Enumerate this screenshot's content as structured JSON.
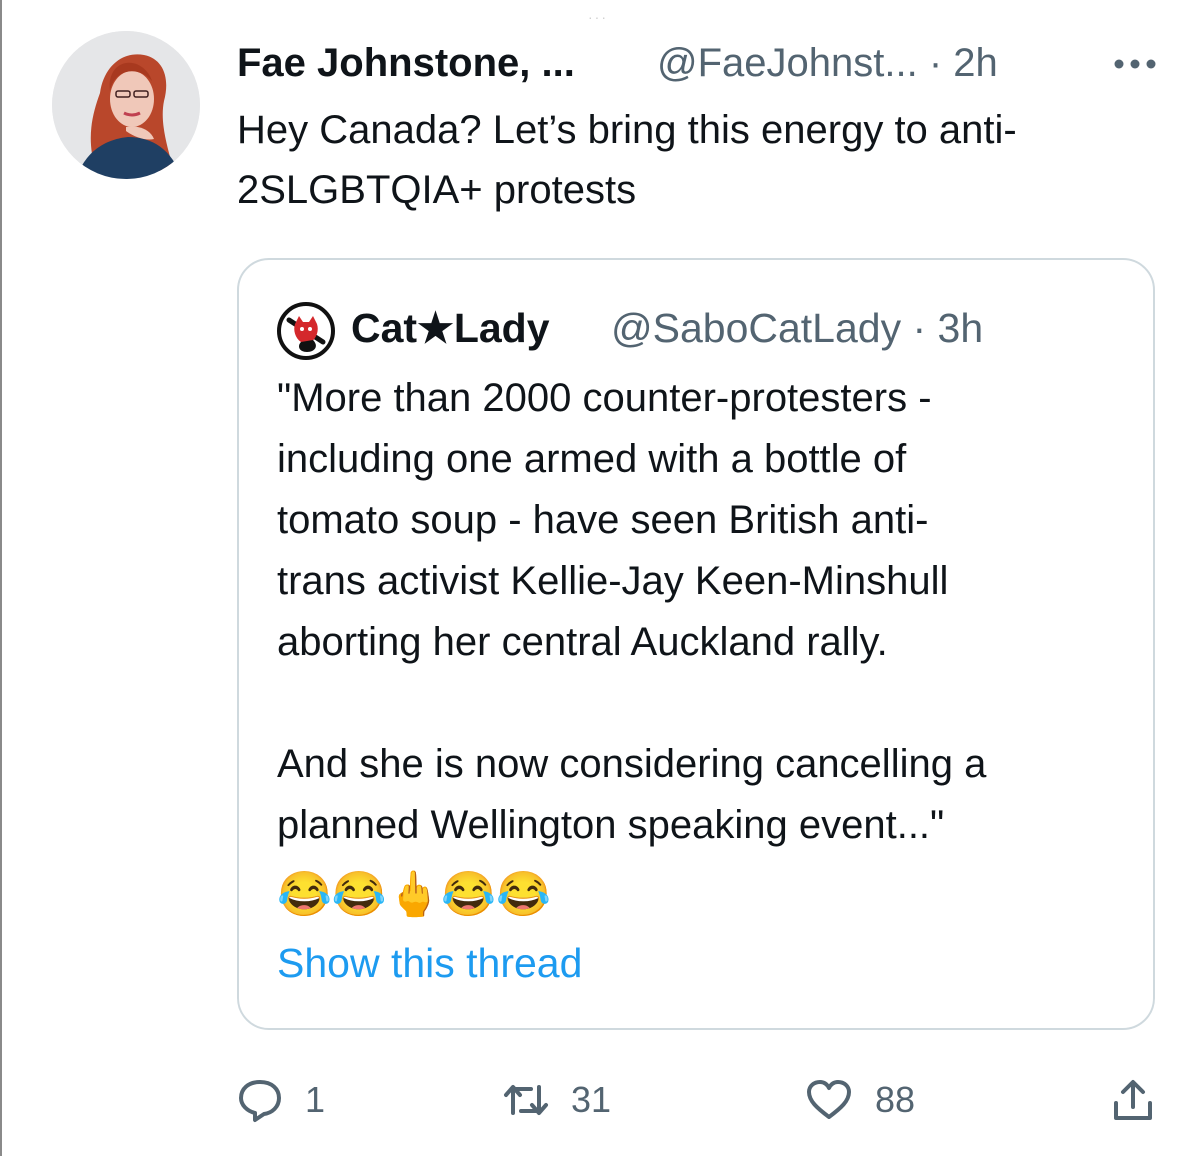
{
  "tweet": {
    "display_name": "Fae Johnstone, ...",
    "handle_time": "@FaeJohnst... · 2h",
    "text": "Hey Canada? Let’s bring this energy to anti-\n2SLGBTQIA+ protests"
  },
  "quoted_tweet": {
    "display_name": "Cat★Lady",
    "handle_time": "@SaboCatLady · 3h",
    "text": "\"More than 2000 counter-protesters -\nincluding one armed with a bottle of\ntomato soup - have seen British anti-\ntrans activist Kellie-Jay Keen-Minshull\naborting her central Auckland rally.\n\nAnd she is now considering cancelling a\nplanned Wellington speaking event...\"",
    "emojis": "😂😂🖕😂😂",
    "show_thread": "Show this thread"
  },
  "actions": {
    "reply_count": "1",
    "retweet_count": "31",
    "like_count": "88"
  },
  "icons": {
    "reply": "reply-icon",
    "retweet": "retweet-icon",
    "like": "heart-icon",
    "share": "share-icon",
    "more": "more-icon"
  },
  "colors": {
    "text_primary": "#0f1419",
    "text_secondary": "#536471",
    "link": "#1d9bf0",
    "card_border": "#cfd9de"
  }
}
